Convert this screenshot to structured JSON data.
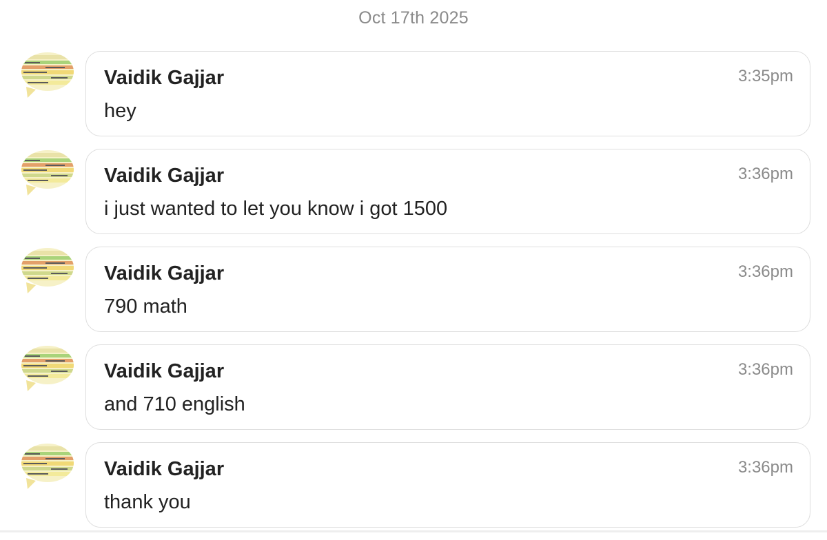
{
  "date_header": "Oct 17th 2025",
  "messages": [
    {
      "sender": "Vaidik Gajjar",
      "time": "3:35pm",
      "text": "hey",
      "avatar": "code-snippet-speech-bubble-avatar"
    },
    {
      "sender": "Vaidik Gajjar",
      "time": "3:36pm",
      "text": "i just wanted to let you know i got 1500",
      "avatar": "code-snippet-speech-bubble-avatar"
    },
    {
      "sender": "Vaidik Gajjar",
      "time": "3:36pm",
      "text": "790 math",
      "avatar": "code-snippet-speech-bubble-avatar"
    },
    {
      "sender": "Vaidik Gajjar",
      "time": "3:36pm",
      "text": "and 710 english",
      "avatar": "code-snippet-speech-bubble-avatar"
    },
    {
      "sender": "Vaidik Gajjar",
      "time": "3:36pm",
      "text": "thank you",
      "avatar": "code-snippet-speech-bubble-avatar"
    }
  ]
}
